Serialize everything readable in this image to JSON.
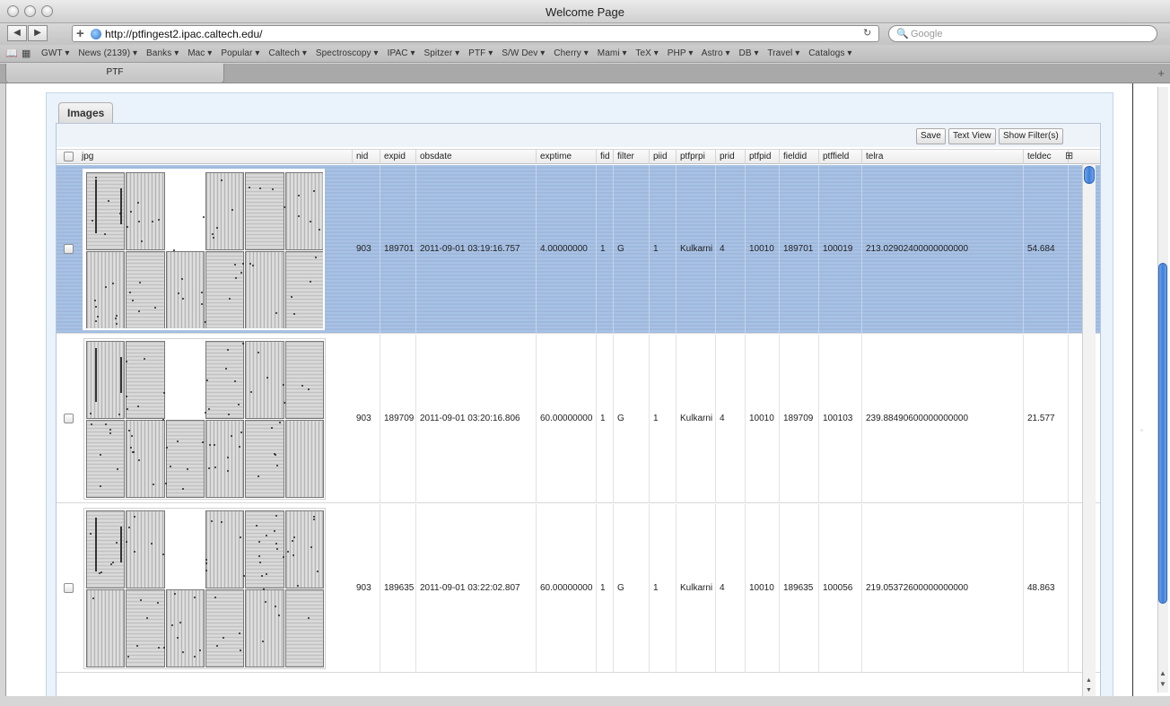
{
  "window": {
    "title": "Welcome Page"
  },
  "toolbar": {
    "back_glyph": "◀",
    "forward_glyph": "▶",
    "url": "http://ptfingest2.ipac.caltech.edu/",
    "search_placeholder": "Google"
  },
  "bookmarks": {
    "items": [
      "GWT ▾",
      "News (2139) ▾",
      "Banks ▾",
      "Mac ▾",
      "Popular ▾",
      "Caltech ▾",
      "Spectroscopy ▾",
      "IPAC ▾",
      "Spitzer ▾",
      "PTF ▾",
      "S/W Dev ▾",
      "Cherry ▾",
      "Mami ▾",
      "TeX ▾",
      "PHP ▾",
      "Astro ▾",
      "DB ▾",
      "Travel ▾",
      "Catalogs ▾"
    ]
  },
  "tabs": [
    {
      "label": "PTF"
    }
  ],
  "panel": {
    "tab_label": "Images",
    "buttons": {
      "save": "Save",
      "text_view": "Text View",
      "show_filter": "Show Filter(s)"
    }
  },
  "table": {
    "columns": [
      "jpg",
      "nid",
      "expid",
      "obsdate",
      "exptime",
      "fid",
      "filter",
      "piid",
      "ptfprpi",
      "prid",
      "ptfpid",
      "fieldid",
      "ptffield",
      "telra",
      "teldec"
    ],
    "rows": [
      {
        "selected": true,
        "nid": "903",
        "expid": "189701",
        "obsdate": "2011-09-01 03:19:16.757",
        "exptime": "4.00000000",
        "fid": "1",
        "filter": "G",
        "piid": "1",
        "ptfprpi": "Kulkarni",
        "prid": "4",
        "ptfpid": "10010",
        "fieldid": "189701",
        "ptffield": "100019",
        "telra": "213.02902400000000000",
        "teldec": "54.684"
      },
      {
        "selected": false,
        "nid": "903",
        "expid": "189709",
        "obsdate": "2011-09-01 03:20:16.806",
        "exptime": "60.00000000",
        "fid": "1",
        "filter": "G",
        "piid": "1",
        "ptfprpi": "Kulkarni",
        "prid": "4",
        "ptfpid": "10010",
        "fieldid": "189709",
        "ptffield": "100103",
        "telra": "239.88490600000000000",
        "teldec": "21.577"
      },
      {
        "selected": false,
        "nid": "903",
        "expid": "189635",
        "obsdate": "2011-09-01 03:22:02.807",
        "exptime": "60.00000000",
        "fid": "1",
        "filter": "G",
        "piid": "1",
        "ptfprpi": "Kulkarni",
        "prid": "4",
        "ptfpid": "10010",
        "fieldid": "189635",
        "ptffield": "100056",
        "telra": "219.05372600000000000",
        "teldec": "48.863"
      }
    ]
  },
  "colors": {
    "selection": "#a9c2e4",
    "accent": "#3e7fd8"
  }
}
